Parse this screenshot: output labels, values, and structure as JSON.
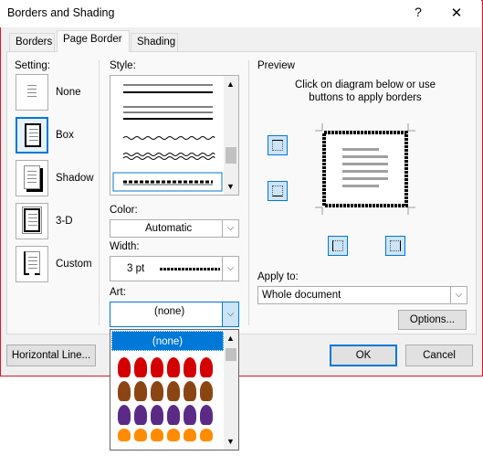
{
  "window": {
    "title": "Borders and Shading",
    "help_glyph": "?",
    "close_glyph": "✕"
  },
  "tabs": [
    {
      "label": "Borders",
      "active": false
    },
    {
      "label": "Page Border",
      "active": true
    },
    {
      "label": "Shading",
      "active": false
    }
  ],
  "setting": {
    "label": "Setting:",
    "options": [
      {
        "label": "None",
        "selected": false
      },
      {
        "label": "Box",
        "selected": true
      },
      {
        "label": "Shadow",
        "selected": false
      },
      {
        "label": "3-D",
        "selected": false
      },
      {
        "label": "Custom",
        "selected": false
      }
    ]
  },
  "style": {
    "label": "Style:"
  },
  "color": {
    "label": "Color:",
    "value": "Automatic"
  },
  "width": {
    "label": "Width:",
    "value": "3 pt"
  },
  "art": {
    "label": "Art:",
    "value": "(none)",
    "dropdown_selected": "(none)"
  },
  "preview": {
    "label": "Preview",
    "instruction": "Click on diagram below or use buttons to apply borders"
  },
  "apply_to": {
    "label": "Apply to:",
    "value": "Whole document"
  },
  "buttons": {
    "options": "Options...",
    "horizontal_line": "Horizontal Line...",
    "ok": "OK",
    "cancel": "Cancel"
  },
  "colors": {
    "accent": "#0078d7",
    "title_close_hover": "#e81123",
    "art_red": "#d40000",
    "art_brown": "#8b4513",
    "art_purple": "#5b2a86",
    "art_orange": "#ff8c00"
  }
}
